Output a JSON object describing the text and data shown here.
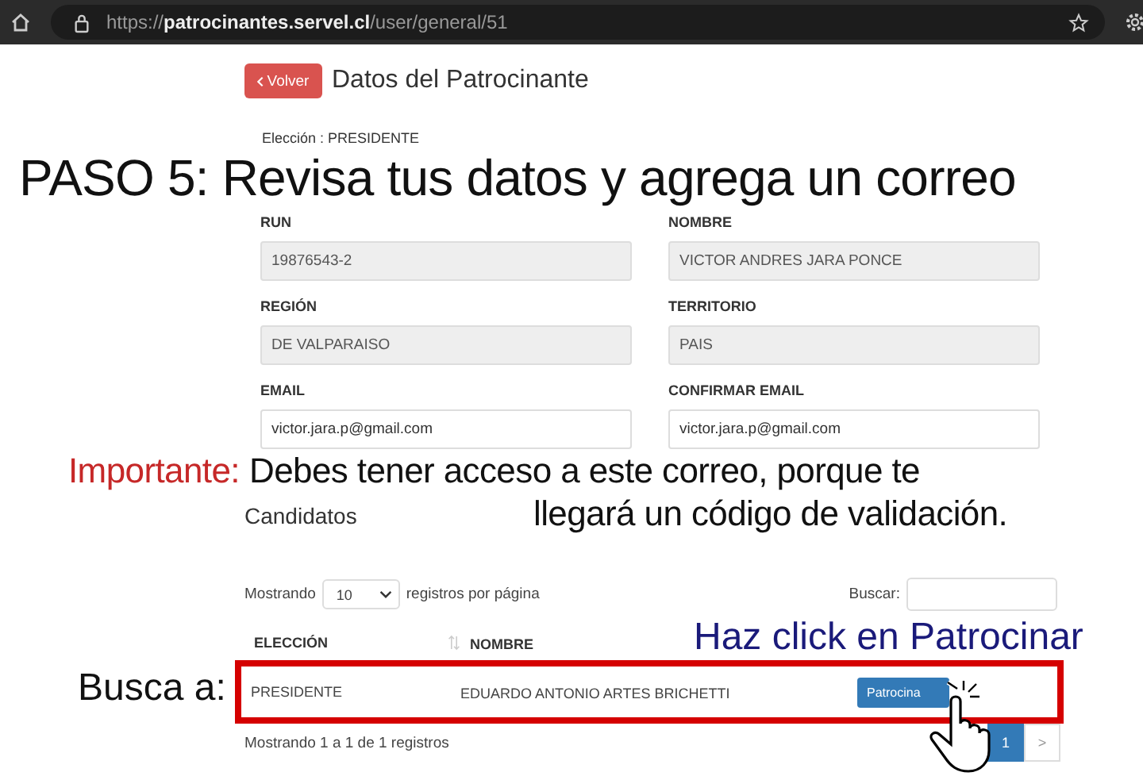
{
  "browser": {
    "url": "https://**patrocinantes.servel.cl**/user/general/51"
  },
  "page": {
    "back_button": "Volver",
    "title": "Datos del Patrocinante",
    "election": "Elección : PRESIDENTE"
  },
  "fields": [
    {
      "label": "RUN",
      "value": "19876543-2",
      "disabled": true
    },
    {
      "label": "NOMBRE",
      "value": "VICTOR ANDRES JARA PONCE",
      "disabled": true
    },
    {
      "label": "REGIÓN",
      "value": "DE VALPARAISO",
      "disabled": true
    },
    {
      "label": "TERRITORIO",
      "value": "PAIS",
      "disabled": true
    },
    {
      "label": "EMAIL",
      "value": "victor.jara.p@gmail.com",
      "disabled": false
    },
    {
      "label": "CONFIRMAR EMAIL",
      "value": "victor.jara.p@gmail.com",
      "disabled": false
    }
  ],
  "candidates": {
    "title": "Candidatos",
    "length_before": "Mostrando",
    "length_value": "10",
    "length_after": "registros por página",
    "search_label": "Buscar:",
    "columns": [
      "ELECCIÓN",
      "NOMBRE"
    ],
    "rows": [
      {
        "election": "PRESIDENTE",
        "name": "EDUARDO ANTONIO ARTES BRICHETTI",
        "action": "Patrocina"
      }
    ],
    "info": "Mostrando 1 a 1 de 1 registros",
    "pagination": [
      {
        "label": "1",
        "selected": true
      },
      {
        "label": ">",
        "selected": false
      }
    ]
  },
  "annotations": {
    "step": "PASO 5: Revisa tus datos y agrega un correo",
    "note_highlight": "Importante:",
    "note_lines": [
      "Debes tener acceso a este correo, porque te",
      "llegará un código de validación."
    ],
    "search_hint": "Busca a:",
    "click_hint": "Haz click en Patrocinar"
  }
}
